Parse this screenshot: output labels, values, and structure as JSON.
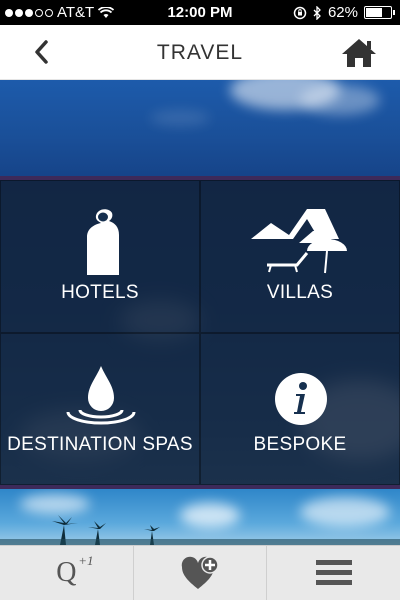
{
  "status_bar": {
    "carrier": "AT&T",
    "time": "12:00 PM",
    "battery": "62%",
    "battery_level": 0.62
  },
  "nav": {
    "title": "TRAVEL"
  },
  "tiles": [
    {
      "label": "HOTELS",
      "icon": "door-hanger-icon"
    },
    {
      "label": "VILLAS",
      "icon": "villa-umbrella-icon"
    },
    {
      "label": "DESTINATION SPAS",
      "icon": "water-drop-icon"
    },
    {
      "label": "BESPOKE",
      "icon": "info-icon"
    }
  ],
  "tabbar": {
    "q_label": "Q",
    "q_superscript": "+1",
    "icons": [
      "q-plus-one-icon",
      "heart-plus-icon",
      "menu-icon"
    ]
  }
}
